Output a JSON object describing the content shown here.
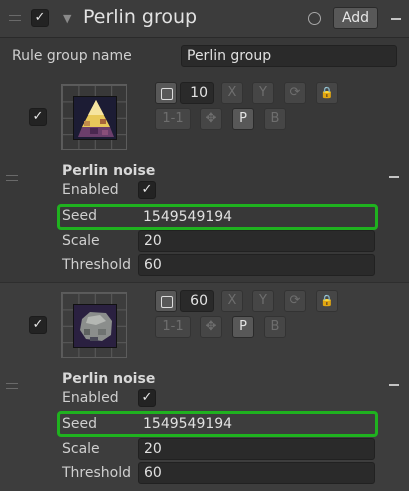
{
  "header": {
    "title": "Perlin group",
    "add_label": "Add",
    "enabled": "✓"
  },
  "rule_group_name": {
    "label": "Rule group name",
    "value": "Perlin group"
  },
  "rules": [
    {
      "enabled_check": "✓",
      "random_count": "10",
      "buttons": {
        "x": "X",
        "y": "Y",
        "rotate": "⟳",
        "lock": "🔒",
        "one_one": "1-1",
        "move": "✥",
        "p": "P",
        "b": "B"
      },
      "section": "Perlin noise",
      "enabled_label": "Enabled",
      "enabled_value": "✓",
      "seed_label": "Seed",
      "seed_value": "1549549194",
      "scale_label": "Scale",
      "scale_value": "20",
      "threshold_label": "Threshold",
      "threshold_value": "60",
      "sprite": "gold-ore-icon"
    },
    {
      "enabled_check": "✓",
      "random_count": "60",
      "buttons": {
        "x": "X",
        "y": "Y",
        "rotate": "⟳",
        "lock": "🔒",
        "one_one": "1-1",
        "move": "✥",
        "p": "P",
        "b": "B"
      },
      "section": "Perlin noise",
      "enabled_label": "Enabled",
      "enabled_value": "✓",
      "seed_label": "Seed",
      "seed_value": "1549549194",
      "scale_label": "Scale",
      "scale_value": "20",
      "threshold_label": "Threshold",
      "threshold_value": "60",
      "sprite": "stone-ore-icon"
    }
  ],
  "colors": {
    "highlight": "#1fb21f",
    "background": "#383838"
  }
}
